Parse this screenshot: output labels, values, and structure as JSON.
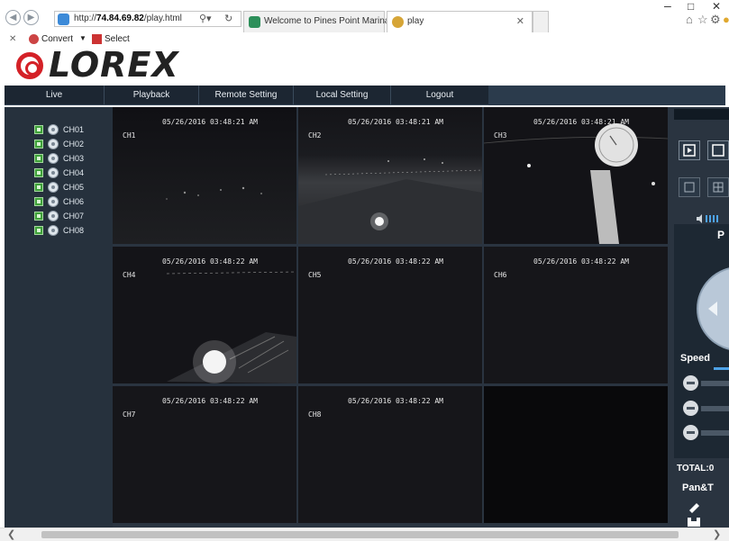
{
  "browser": {
    "url_prefix": "http://",
    "url_host": "74.84.69.82",
    "url_path": "/play.html",
    "tabs": [
      {
        "title": "Welcome to Pines Point Marina"
      },
      {
        "title": "play"
      }
    ],
    "command_bar": {
      "convert_label": "Convert",
      "select_label": "Select"
    },
    "icons": [
      "back-icon",
      "forward-icon",
      "search-icon",
      "refresh-icon",
      "close-tab-icon",
      "minimize-icon",
      "maximize-icon",
      "close-window-icon",
      "home-icon",
      "favorites-icon",
      "settings-icon"
    ]
  },
  "brand": {
    "logo_text": "LOREX",
    "accent": "#d42127"
  },
  "menu": {
    "items": [
      {
        "label": "Live"
      },
      {
        "label": "Playback"
      },
      {
        "label": "Remote Setting"
      },
      {
        "label": "Local Setting"
      },
      {
        "label": "Logout"
      }
    ]
  },
  "channels": [
    {
      "label": "CH01"
    },
    {
      "label": "CH02"
    },
    {
      "label": "CH03"
    },
    {
      "label": "CH04"
    },
    {
      "label": "CH05"
    },
    {
      "label": "CH06"
    },
    {
      "label": "CH07"
    },
    {
      "label": "CH08"
    }
  ],
  "cameras": [
    {
      "label": "CH1",
      "timestamp": "05/26/2016 03:48:21 AM"
    },
    {
      "label": "CH2",
      "timestamp": "05/26/2016 03:48:21 AM"
    },
    {
      "label": "CH3",
      "timestamp": "05/26/2016 03:48:21 AM"
    },
    {
      "label": "CH4",
      "timestamp": "05/26/2016 03:48:22 AM"
    },
    {
      "label": "CH5",
      "timestamp": "05/26/2016 03:48:22 AM"
    },
    {
      "label": "CH6",
      "timestamp": "05/26/2016 03:48:22 AM"
    },
    {
      "label": "CH7",
      "timestamp": "05/26/2016 03:48:22 AM"
    },
    {
      "label": "CH8",
      "timestamp": "05/26/2016 03:48:22 AM"
    },
    {
      "label": "",
      "timestamp": ""
    }
  ],
  "right_panel": {
    "ptz_label": "P",
    "speed_label": "Speed",
    "total_label": "TOTAL:0",
    "pan_tilt_label": "Pan&T"
  }
}
